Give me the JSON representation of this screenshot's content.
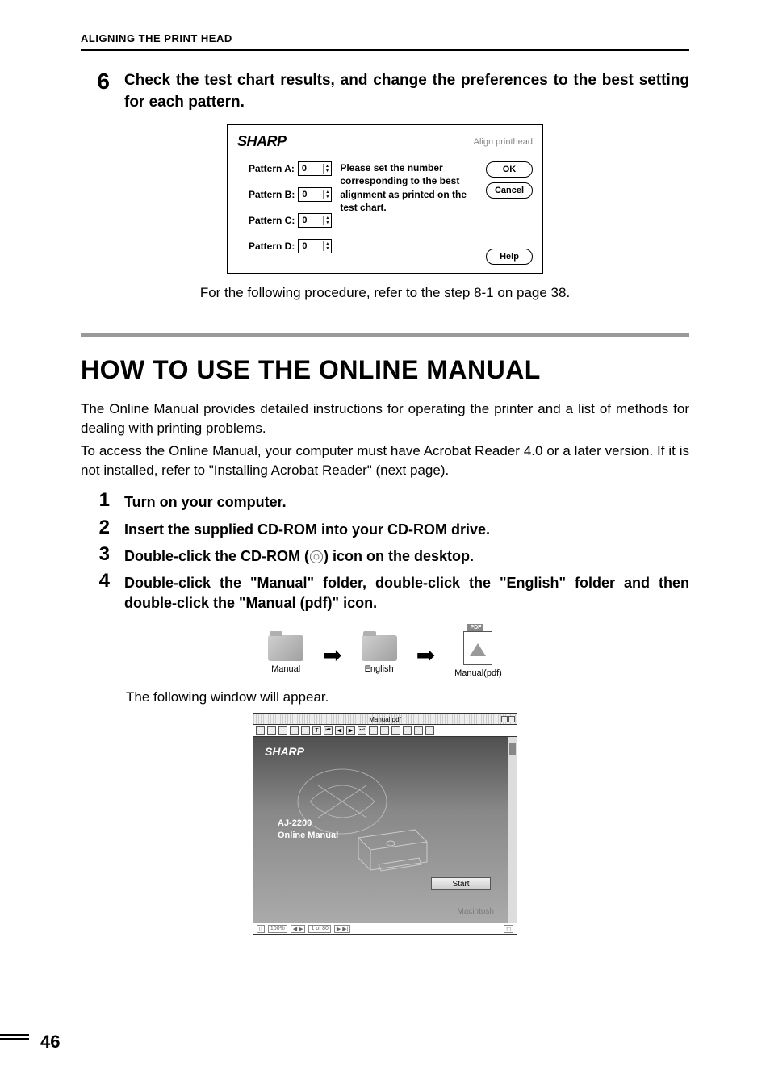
{
  "header": {
    "section_label": "ALIGNING THE PRINT HEAD"
  },
  "step6": {
    "number": "6",
    "text": "Check the test chart results, and change the preferences to the best setting for each pattern."
  },
  "dialog": {
    "logo": "SHARP",
    "title": "Align printhead",
    "patterns": {
      "a_label": "Pattern A:",
      "a_value": "0",
      "b_label": "Pattern B:",
      "b_value": "0",
      "c_label": "Pattern C:",
      "c_value": "0",
      "d_label": "Pattern D:",
      "d_value": "0"
    },
    "instruction": "Please set the number corresponding to the best alignment as printed on the test chart.",
    "buttons": {
      "ok": "OK",
      "cancel": "Cancel",
      "help": "Help"
    }
  },
  "reference_text": "For the following procedure, refer to the step 8-1 on page 38.",
  "section2": {
    "title": "HOW TO USE THE ONLINE MANUAL",
    "para1": "The Online Manual provides detailed instructions for operating the printer and a list of methods for dealing with printing problems.",
    "para2": "To access the Online Manual, your computer must have Acrobat Reader 4.0 or a later version. If it is not installed, refer to \"Installing Acrobat Reader\" (next page)."
  },
  "steps": {
    "s1_num": "1",
    "s1_text": "Turn on your computer.",
    "s2_num": "2",
    "s2_text": "Insert the supplied CD-ROM into your CD-ROM drive.",
    "s3_num": "3",
    "s3_text_a": "Double-click the CD-ROM (",
    "s3_text_b": ") icon on the desktop.",
    "s4_num": "4",
    "s4_text": "Double-click the \"Manual\" folder, double-click the \"English\" folder and then double-click the \"Manual (pdf)\" icon."
  },
  "folder_flow": {
    "label1": "Manual",
    "label2": "English",
    "label3": "Manual(pdf)"
  },
  "follow_text": "The following window will appear.",
  "pdf_window": {
    "titlebar": "Manual.pdf",
    "logo": "SHARP",
    "model_line1": "AJ-2200",
    "model_line2": "Online Manual",
    "start_btn": "Start",
    "mac_label": "Macintosh"
  },
  "page_number": "46"
}
